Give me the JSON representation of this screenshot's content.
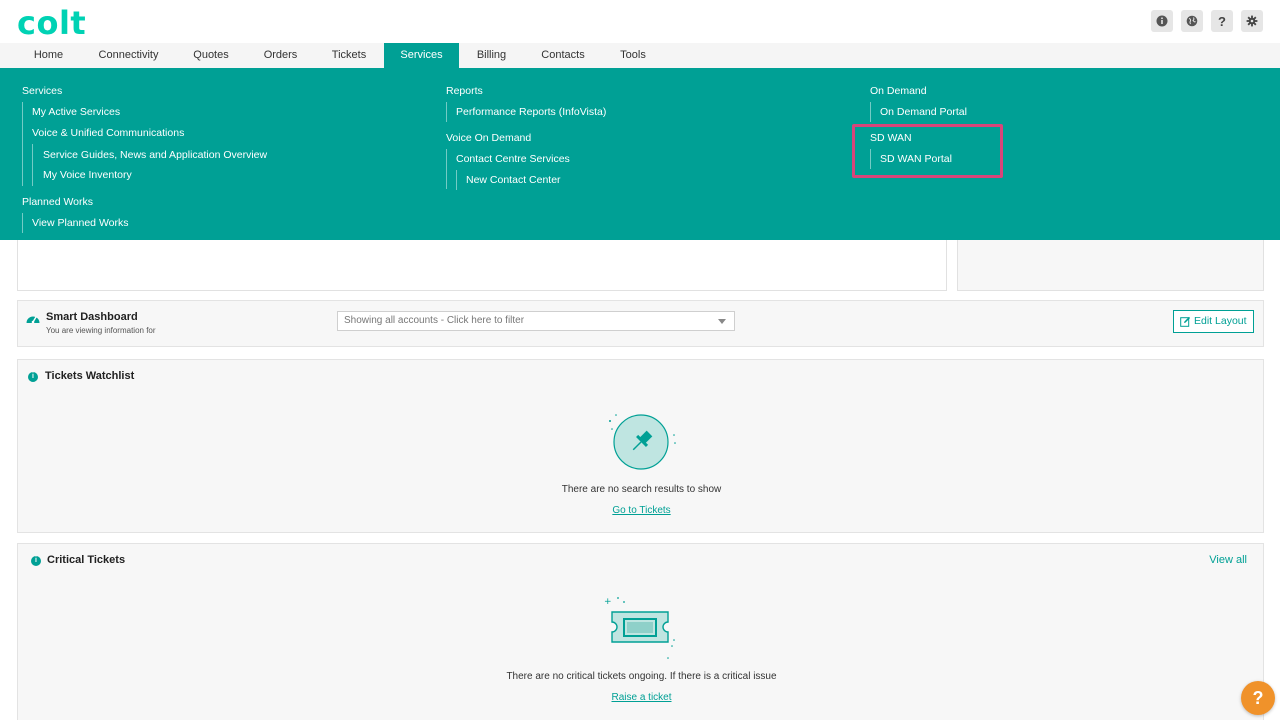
{
  "brand": {
    "logo_text": "colt",
    "accent": "#00a095",
    "logo_color": "#00d2b4"
  },
  "top_icons": [
    "info-icon",
    "globe-icon",
    "help-icon",
    "gear-icon"
  ],
  "nav": {
    "items": [
      "Home",
      "Connectivity",
      "Quotes",
      "Orders",
      "Tickets",
      "Services",
      "Billing",
      "Contacts",
      "Tools"
    ],
    "active": "Services"
  },
  "megamenu": {
    "col1": {
      "services": "Services",
      "my_active_services": "My Active Services",
      "voice_unified": "Voice & Unified Communications",
      "service_guides": "Service Guides, News and Application Overview",
      "my_voice_inventory": "My Voice Inventory",
      "planned_works": "Planned Works",
      "view_planned_works": "View Planned Works"
    },
    "col2": {
      "reports": "Reports",
      "performance_reports": "Performance Reports (InfoVista)",
      "voice_on_demand": "Voice On Demand",
      "contact_centre": "Contact Centre Services",
      "new_contact_center": "New Contact Center"
    },
    "col3": {
      "on_demand": "On Demand",
      "on_demand_portal": "On Demand Portal",
      "sd_wan": "SD WAN",
      "sd_wan_portal": "SD WAN Portal"
    }
  },
  "smart_dashboard": {
    "title": "Smart Dashboard",
    "subtitle": "You are viewing information for",
    "filter_text": "Showing all accounts - Click here to filter",
    "edit_layout": "Edit Layout"
  },
  "tickets_watchlist": {
    "title": "Tickets Watchlist",
    "empty_message": "There are no search results to show",
    "link": "Go to Tickets"
  },
  "critical_tickets": {
    "title": "Critical Tickets",
    "view_all": "View all",
    "empty_message": "There are no critical tickets ongoing. If there is a critical issue",
    "link": "Raise a ticket"
  },
  "help_fab": "?"
}
